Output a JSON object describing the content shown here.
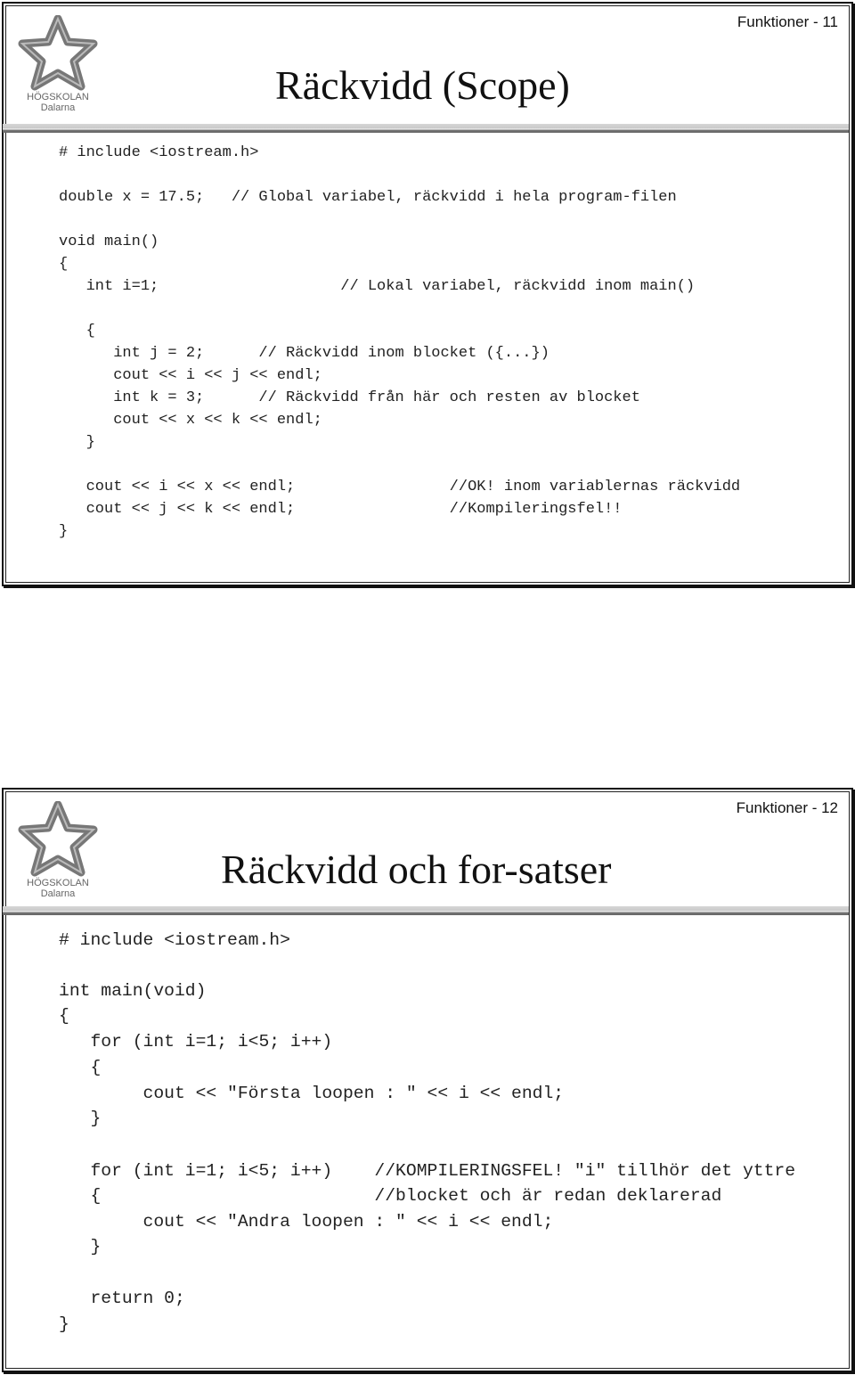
{
  "slides": [
    {
      "number": "Funktioner - 11",
      "title": "Räckvidd (Scope)",
      "logo_text": "HÖGSKOLAN Dalarna",
      "code": [
        "# include <iostream.h>",
        "double x = 17.5;   // Global variabel, räckvidd i hela program-filen",
        "void main()",
        "{",
        "   int i=1;                    // Lokal variabel, räckvidd inom main()",
        "   {",
        "      int j = 2;      // Räckvidd inom blocket ({...})",
        "      cout << i << j << endl;",
        "      int k = 3;      // Räckvidd från här och resten av blocket",
        "      cout << x << k << endl;",
        "   }",
        "   cout << i << x << endl;                 //OK! inom variablernas räckvidd",
        "   cout << j << k << endl;                 //Kompileringsfel!!",
        "}"
      ]
    },
    {
      "number": "Funktioner - 12",
      "title": "Räckvidd och for-satser",
      "logo_text": "HÖGSKOLAN Dalarna",
      "code": [
        "# include <iostream.h>",
        "int main(void)",
        "{",
        "   for (int i=1; i<5; i++)",
        "   {",
        "        cout << \"Första loopen : \" << i << endl;",
        "   }",
        "   for (int i=1; i<5; i++)    //KOMPILERINGSFEL! \"i\" tillhör det yttre",
        "   {                          //blocket och är redan deklarerad",
        "        cout << \"Andra loopen : \" << i << endl;",
        "   }",
        "   return 0;",
        "}"
      ]
    }
  ]
}
